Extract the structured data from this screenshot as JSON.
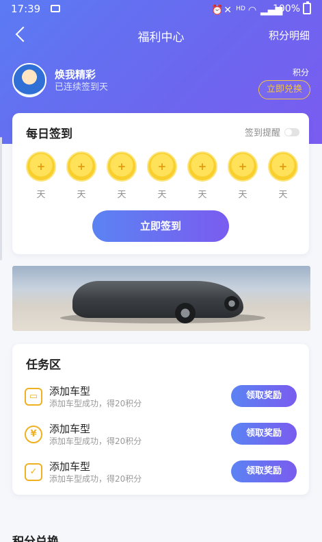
{
  "status": {
    "time": "17:39",
    "battery": "100%",
    "net": "HD"
  },
  "nav": {
    "title": "福利中心",
    "right": "积分明细"
  },
  "user": {
    "name": "焕我精彩",
    "streak_text": "已连续签到天",
    "points_label": "积分",
    "redeem_label": "立即兑换"
  },
  "checkin": {
    "title": "每日签到",
    "reminder_label": "签到提醒",
    "reminder_on": false,
    "days": [
      {
        "coin": "+",
        "label": "天"
      },
      {
        "coin": "+",
        "label": "天"
      },
      {
        "coin": "+",
        "label": "天"
      },
      {
        "coin": "+",
        "label": "天"
      },
      {
        "coin": "+",
        "label": "天"
      },
      {
        "coin": "+",
        "label": "天"
      },
      {
        "coin": "+",
        "label": "天"
      }
    ],
    "button": "立即签到"
  },
  "tasks": {
    "title": "任务区",
    "items": [
      {
        "icon": "car-icon",
        "title": "添加车型",
        "desc": "添加车型成功，得20积分",
        "button": "领取奖励"
      },
      {
        "icon": "coin-yen-icon",
        "title": "添加车型",
        "desc": "添加车型成功，得20积分",
        "button": "领取奖励"
      },
      {
        "icon": "checklist-icon",
        "title": "添加车型",
        "desc": "添加车型成功，得20积分",
        "button": "领取奖励"
      }
    ]
  },
  "exchange": {
    "title": "积分兑换"
  },
  "colors": {
    "accent_start": "#5b83f2",
    "accent_end": "#7a5cf0",
    "gold": "#f4c441"
  }
}
